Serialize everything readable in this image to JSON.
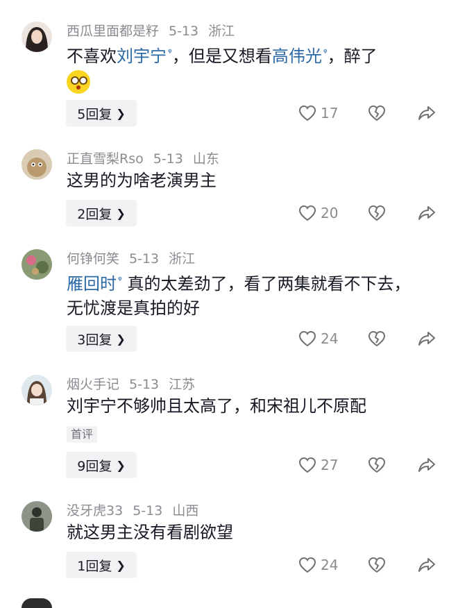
{
  "comments": [
    {
      "username": "西瓜里面都是籽",
      "date": "5-13",
      "location": "浙江",
      "text_pre": "不喜欢",
      "mention1": "刘宇宁",
      "text_mid": "，但是又想看",
      "mention2": "高伟光",
      "text_post": "，醉了",
      "reply_label": "5回复",
      "likes": "17",
      "avatar_color": "#e9ddd6"
    },
    {
      "username": "正直雪梨Rso",
      "date": "5-13",
      "location": "山东",
      "text": "这男的为啥老演男主",
      "reply_label": "2回复",
      "likes": "20",
      "avatar_color": "#c9b79a"
    },
    {
      "username": "何铮何笑",
      "date": "5-13",
      "location": "浙江",
      "mention1": "雁回时",
      "text_post": "真的太差劲了，看了两集就看不下去，无忧渡是真拍的好",
      "reply_label": "3回复",
      "likes": "24",
      "avatar_color": "#7d8f6a"
    },
    {
      "username": "烟火手记",
      "date": "5-13",
      "location": "江苏",
      "text": "刘宇宁不够帅且太高了，和宋祖儿不原配",
      "badge": "首评",
      "reply_label": "9回复",
      "likes": "27",
      "avatar_color": "#d8e4ea"
    },
    {
      "username": "没牙虎33",
      "date": "5-13",
      "location": "山西",
      "text": "就这男主没有看剧欲望",
      "reply_label": "1回复",
      "likes": "24",
      "avatar_color": "#6f776b"
    }
  ],
  "icons": {
    "mention": "search-mark",
    "emoji": "dizzy-face-emoji",
    "like": "heart-outline-icon",
    "dislike": "broken-heart-icon",
    "share": "share-arrow-icon",
    "chevron": "chevron-right-icon"
  }
}
